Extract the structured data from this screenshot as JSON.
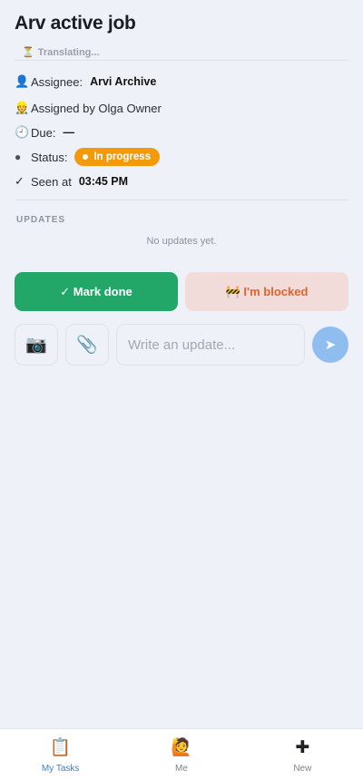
{
  "job": {
    "title": "Arv active job",
    "translating": "Translating...",
    "translating_icon": "⏳"
  },
  "details": {
    "assignee_icon": "👤",
    "assignee_label": "Assignee:",
    "assignee_value": "Arvi Archive",
    "assigned_by_icon": "👷",
    "assigned_by_text": "Assigned by Olga Owner",
    "due_icon": "🕘",
    "due_label": "Due:",
    "due_value": "—",
    "status_icon": "●",
    "status_label": "Status:",
    "status_value": "In progress",
    "seen_icon": "✓",
    "seen_label": "Seen at",
    "seen_value": "03:45 PM"
  },
  "updates": {
    "heading": "UPDATES",
    "empty_text": "No updates yet."
  },
  "actions": {
    "done_label": "✓ Mark done",
    "blocked_label": "🚧 I'm blocked"
  },
  "composer": {
    "camera_icon": "📷",
    "attach_icon": "📎",
    "placeholder": "Write an update...",
    "send_icon": "➤"
  },
  "tabs": [
    {
      "icon": "📋",
      "label": "My Tasks"
    },
    {
      "icon": "🙋",
      "label": "Me"
    },
    {
      "icon": "✚",
      "label": "New"
    }
  ],
  "colors": {
    "accent": "#3c7be0",
    "done": "#23a769",
    "blocked_bg": "#f2dcda",
    "blocked_text": "#e0632d",
    "status_badge": "#f29a0c"
  }
}
